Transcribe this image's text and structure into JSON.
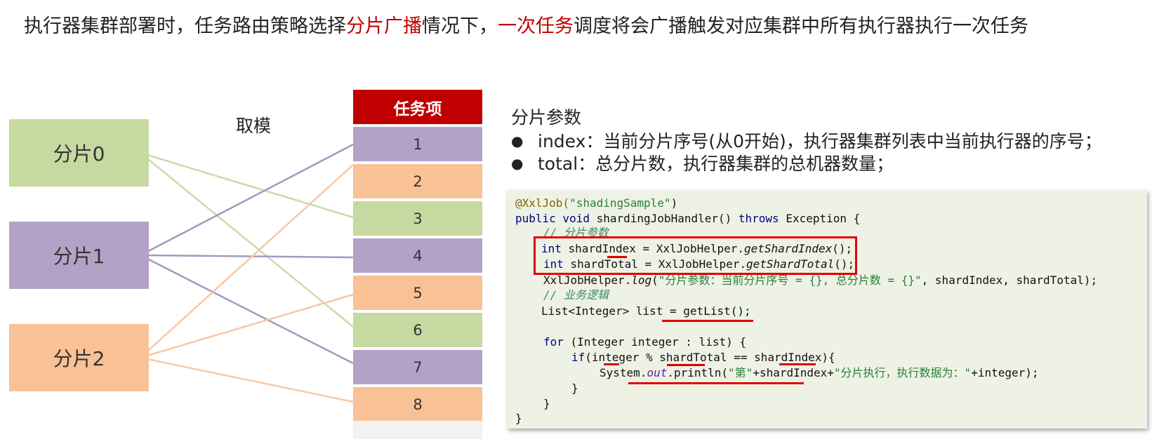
{
  "headline": {
    "part1": "执行器集群部署时，任务路由策略选择",
    "highlight1": "分片广播",
    "part2": "情况下，",
    "highlight2": "一次任务",
    "part3": "调度将会广播触发对应集群中所有执行器执行一次任务"
  },
  "shards": [
    {
      "label": "分片0",
      "color": "#c6d9a0"
    },
    {
      "label": "分片1",
      "color": "#b3a2c7"
    },
    {
      "label": "分片2",
      "color": "#f9c196"
    }
  ],
  "mod_label": "取模",
  "task_header": "任务项",
  "tasks": [
    "1",
    "2",
    "3",
    "4",
    "5",
    "6",
    "7",
    "8"
  ],
  "params": {
    "title": "分片参数",
    "items": [
      "index：当前分片序号(从0开始)，执行器集群列表中当前执行器的序号；",
      "total：总分片数，执行器集群的总机器数量；"
    ]
  },
  "code": {
    "l1_ann": "@XxlJob(",
    "l1_str": "\"shadingSample\"",
    "l1_end": ")",
    "l2_kw": "public void",
    "l2_mid": " shardingJobHandler() ",
    "l2_kw2": "throws",
    "l2_end": " Exception {",
    "l3": "// 分片参数",
    "l4_kw": "int",
    "l4_mid": " shardIndex = XxlJobHelper.",
    "l4_it": "getShardIndex",
    "l4_end": "();",
    "l5_kw": "int",
    "l5_mid": " shardTotal = XxlJobHelper.",
    "l5_it": "getShardTotal",
    "l5_end": "();",
    "l6_a": "XxlJobHelper.",
    "l6_it": "log",
    "l6_b": "(",
    "l6_str": "\"分片参数：当前分片序号 = {}, 总分片数 = {}\"",
    "l6_end": ", shardIndex, shardTotal);",
    "l7": "// 业务逻辑",
    "l8": "List<Integer> list = getList();",
    "l9_kw": "for",
    "l9_end": " (Integer integer : list) {",
    "l10_kw": "if",
    "l10_end": "(integer % shardTotal == shardIndex){",
    "l11_a": "System.",
    "l11_field": "out",
    "l11_b": ".println(",
    "l11_str1": "\"第\"",
    "l11_c": "+shardIndex+",
    "l11_str2": "\"分片执行，执行数据为：\"",
    "l11_end": "+integer);",
    "l12": "}",
    "l13": "}",
    "l14": "}"
  }
}
